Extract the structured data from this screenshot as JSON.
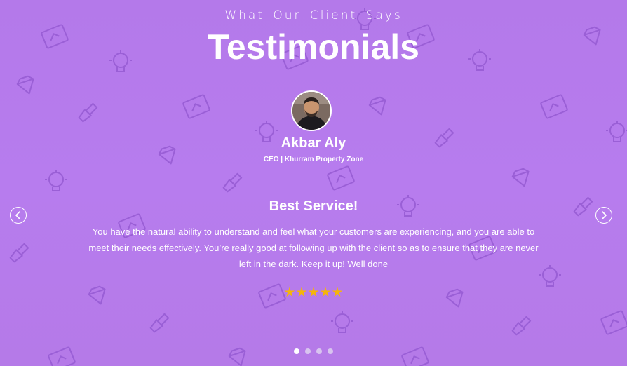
{
  "section": {
    "eyebrow": "What Our Client Says",
    "title": "Testimonials"
  },
  "testimonial": {
    "name": "Akbar Aly",
    "role": "CEO | Khurram Property Zone",
    "quote_title": "Best Service!",
    "quote": "You have the natural ability to understand and feel what your customers are experiencing, and you are able to meet their needs effectively. You’re really good at following up with the client so as to ensure that they are never left in the dark. Keep it up! Well done",
    "rating": 5,
    "stars": "★★★★★"
  },
  "carousel": {
    "prev_icon": "chevron-left-icon",
    "next_icon": "chevron-right-icon",
    "dot_count": 4,
    "active_index": 0
  },
  "colors": {
    "background": "#b77cee",
    "star": "#f5b50a",
    "text": "#ffffff"
  }
}
